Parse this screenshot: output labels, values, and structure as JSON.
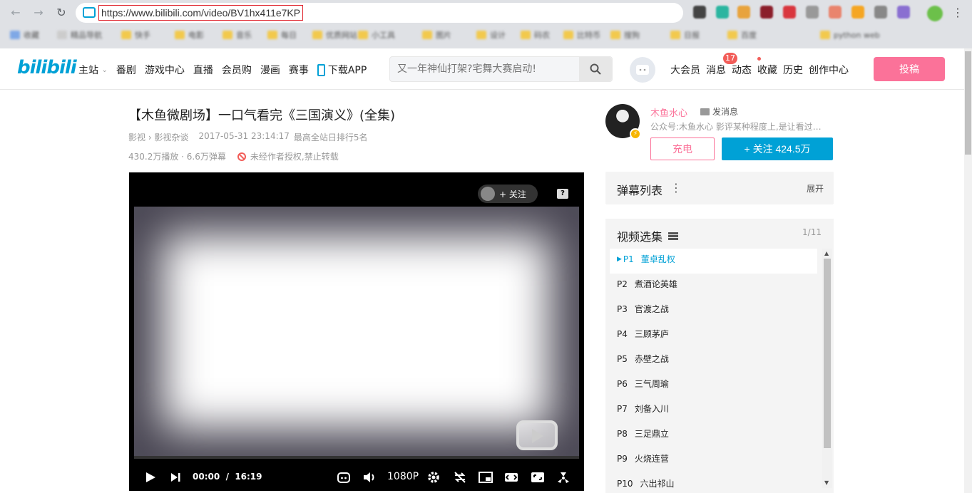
{
  "browser": {
    "url": "https://www.bilibili.com/video/BV1hx411e7KP",
    "bookmarks": [
      "收藏",
      "精品导航",
      "快手",
      "电影",
      "音乐",
      "每日",
      "优质网站",
      "小工具",
      "图片",
      "设计",
      "码农",
      "比特币",
      "搜狗",
      "日报",
      "百度",
      "python web"
    ]
  },
  "header": {
    "logo": "bilibili",
    "nav": [
      "主站",
      "番剧",
      "游戏中心",
      "直播",
      "会员购",
      "漫画",
      "赛事",
      "下载APP"
    ],
    "search_placeholder": "又一年神仙打架?宅舞大赛启动!",
    "right_links": [
      "大会员",
      "消息",
      "动态",
      "收藏",
      "历史",
      "创作中心"
    ],
    "message_badge": "17",
    "upload_label": "投稿"
  },
  "video": {
    "title": "【木鱼微剧场】一口气看完《三国演义》(全集)",
    "category": "影视 › 影视杂谈",
    "date": "2017-05-31 23:14:17",
    "rank": "最高全站日排行5名",
    "plays": "430.2万播放 · 6.6万弹幕",
    "copyright": "未经作者授权,禁止转载"
  },
  "player": {
    "follow_label": "+ 关注",
    "help_label": "?",
    "time_current": "00:00",
    "time_separator": "/",
    "time_total": "16:19",
    "quality": "1080P",
    "progress": 0
  },
  "uploader": {
    "name": "木鱼水心",
    "message_label": "发消息",
    "desc": "公众号:木鱼水心 影评某种程度上,是让看过…",
    "charge_label": "充电",
    "follow_label": "+ 关注 424.5万"
  },
  "danmaku": {
    "title": "弹幕列表",
    "more": "⋮",
    "expand": "展开"
  },
  "playlist": {
    "title": "视频选集",
    "count": "1/11",
    "items": [
      {
        "p": "P1",
        "name": "董卓乱权"
      },
      {
        "p": "P2",
        "name": "煮酒论英雄"
      },
      {
        "p": "P3",
        "name": "官渡之战"
      },
      {
        "p": "P4",
        "name": "三顾茅庐"
      },
      {
        "p": "P5",
        "name": "赤壁之战"
      },
      {
        "p": "P6",
        "name": "三气周瑜"
      },
      {
        "p": "P7",
        "name": "刘备入川"
      },
      {
        "p": "P8",
        "name": "三足鼎立"
      },
      {
        "p": "P9",
        "name": "火烧连营"
      },
      {
        "p": "P10",
        "name": "六出祁山"
      }
    ]
  },
  "colors": {
    "accent": "#00a1d6",
    "pink": "#fb7299",
    "red": "#f25d59"
  }
}
